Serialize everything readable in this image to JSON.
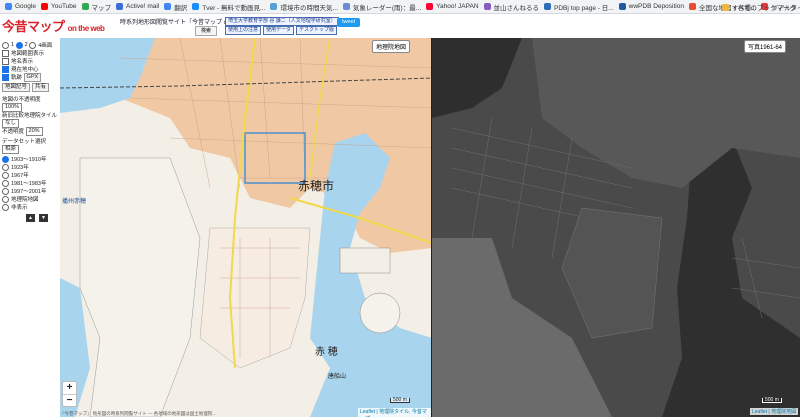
{
  "bookmarks": {
    "items": [
      {
        "label": "Google",
        "color": "#4285f4"
      },
      {
        "label": "YouTube",
        "color": "#ff0000"
      },
      {
        "label": "マップ",
        "color": "#34a853"
      },
      {
        "label": "Active! mail",
        "color": "#3a6fd8"
      },
      {
        "label": "翻訳",
        "color": "#4285f4"
      },
      {
        "label": "Tver - 無料で動画見...",
        "color": "#1a8cff"
      },
      {
        "label": " 環境市の時間天気...",
        "color": "#56a0d3"
      },
      {
        "label": "気象レーダー(雨)：最...",
        "color": "#6b8bd6"
      },
      {
        "label": "Yahoo! JAPAN",
        "color": "#ff0033"
      },
      {
        "label": "並山さんねるる",
        "color": "#8a5cc2"
      },
      {
        "label": "PDBj top page - 日...",
        "color": "#2a6ebb"
      },
      {
        "label": "wwPDB Deposition",
        "color": "#1c5aa6"
      },
      {
        "label": "全国な地図・各種...",
        "color": "#e94b35"
      },
      {
        "label": "リアルタイム震度...",
        "color": "#e03b3b"
      }
    ],
    "all_label": "すべてのブックマーク"
  },
  "header": {
    "logo_main": "今昔マップ",
    "logo_sub": "on the web",
    "site_title": "時系列地形図閲覧サイト「今昔マップ on the web」",
    "search_label": "検索",
    "credit": "埼玉大学教育学部 谷 謙二（人文地理学研究室）",
    "links": [
      "使用上の注意",
      "使用データ",
      "デスクトップ版"
    ],
    "tweet_label": "tweet"
  },
  "panel": {
    "split_label": "1",
    "split_label2": "2",
    "split_label3": "4画面",
    "opts": [
      "地図範囲表示",
      "地名表示"
    ],
    "center_label": "現在地中心",
    "track_label": "軌跡",
    "gpx_label": "GPX",
    "record_label": "地図記号",
    "share_label": "共有",
    "opacity_title": "地図の不透明度",
    "opacity_value": "100%",
    "base_title": "新旧比較地理院タイル",
    "base_value": "なし",
    "base_opacity_title": "不透明度",
    "base_opacity_value": "20%",
    "dataset_title": "データセット選択",
    "dataset_value": "相原",
    "periods": [
      "1903〜1910年",
      "1923年",
      "1967年",
      "1981〜1983年",
      "1997〜2001年",
      "地理院地図",
      "非表示"
    ],
    "selected_period": 0
  },
  "map_left": {
    "selector": "地理院地図",
    "city_label": "赤穂市",
    "city_label2": "赤 穂",
    "mountain_label": "唐船山",
    "station_label": "播州赤穂",
    "scale_label": "500 m",
    "attribution": "Leaflet | 地理院タイル, 今昔マップ"
  },
  "map_right": {
    "selector": "写真1961-64",
    "scale_label": "500 m",
    "attribution": "Leaflet | 地理院地図"
  },
  "zoom": {
    "in": "+",
    "out": "−"
  },
  "footer": "『今昔マップ』 地形図の時系列閲覧サイト ― 各地域の地形図は国土地理院…"
}
